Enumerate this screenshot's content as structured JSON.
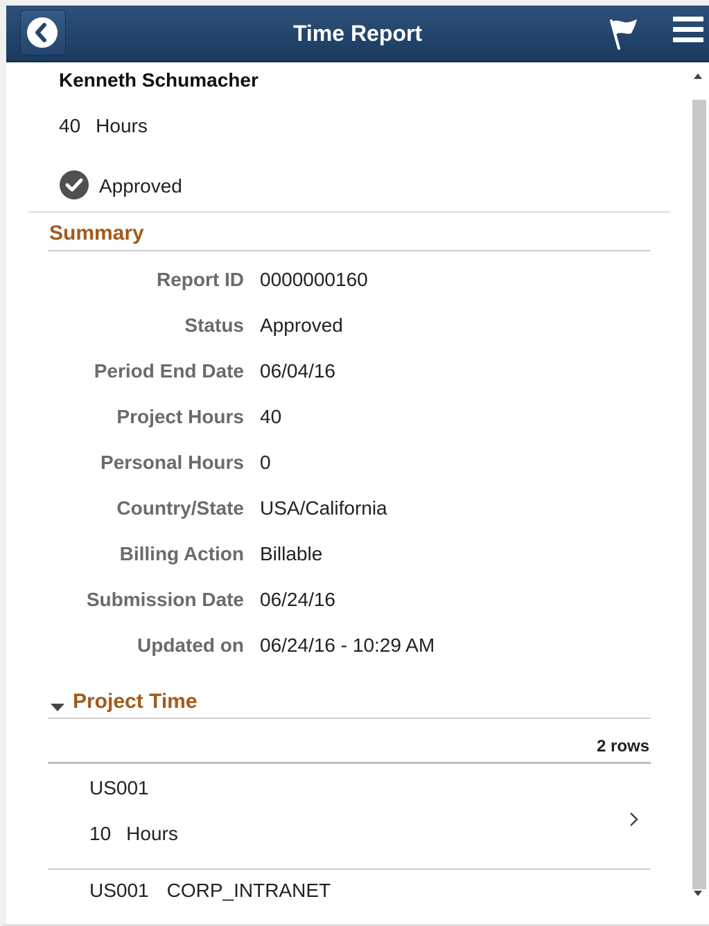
{
  "header": {
    "title": "Time Report",
    "icons": {
      "back": "chevron-left-icon",
      "flag": "flag-icon",
      "menu": "hamburger-menu-icon"
    }
  },
  "employee": {
    "name": "Kenneth Schumacher",
    "total_hours": "40",
    "hours_unit": "Hours",
    "status": "Approved",
    "status_icon": "check-circle-icon"
  },
  "summary": {
    "title": "Summary",
    "fields": [
      {
        "label": "Report ID",
        "value": "0000000160"
      },
      {
        "label": "Status",
        "value": "Approved"
      },
      {
        "label": "Period End Date",
        "value": "06/04/16"
      },
      {
        "label": "Project Hours",
        "value": "40"
      },
      {
        "label": "Personal Hours",
        "value": "0"
      },
      {
        "label": "Country/State",
        "value": "USA/California"
      },
      {
        "label": "Billing Action",
        "value": "Billable"
      },
      {
        "label": "Submission Date",
        "value": "06/24/16"
      },
      {
        "label": "Updated on",
        "value": "06/24/16 - 10:29 AM"
      }
    ]
  },
  "project_time": {
    "title": "Project Time",
    "rows_label": "2 rows",
    "items": [
      {
        "id": "US001",
        "name": "",
        "hours": "10",
        "unit": "Hours"
      },
      {
        "id": "US001",
        "name": "CORP_INTRANET"
      }
    ]
  },
  "colors": {
    "header_bg": "#24456b",
    "section_title": "#a25a1c",
    "label_gray": "#6b6b6b"
  }
}
